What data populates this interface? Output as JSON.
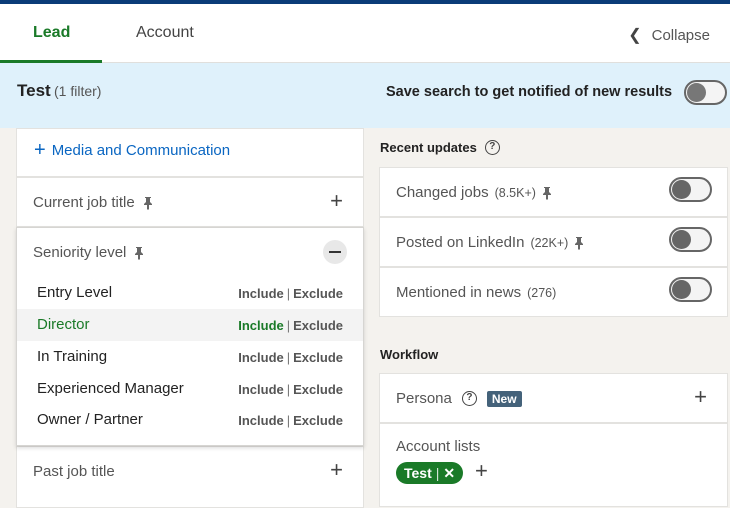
{
  "tabs": {
    "lead": "Lead",
    "account": "Account",
    "collapse": "Collapse"
  },
  "banner": {
    "title": "Test",
    "filter_count": "(1 filter)",
    "save_text": "Save search to get notified of new results"
  },
  "left": {
    "media_label": "Media and Communication",
    "job_title": "Current job title",
    "seniority_title": "Seniority level",
    "seniority_items": [
      {
        "name": "Entry Level",
        "include": "Include",
        "exclude": "Exclude"
      },
      {
        "name": "Director",
        "include": "Include",
        "exclude": "Exclude"
      },
      {
        "name": "In Training",
        "include": "Include",
        "exclude": "Exclude"
      },
      {
        "name": "Experienced Manager",
        "include": "Include",
        "exclude": "Exclude"
      },
      {
        "name": "Owner / Partner",
        "include": "Include",
        "exclude": "Exclude"
      }
    ],
    "separator": "|",
    "past_job_title": "Past job title"
  },
  "right": {
    "recent_updates_title": "Recent updates",
    "updates": [
      {
        "label": "Changed jobs",
        "count": "(8.5K+)"
      },
      {
        "label": "Posted on LinkedIn",
        "count": "(22K+)"
      },
      {
        "label": "Mentioned in news",
        "count": "(276)"
      }
    ],
    "workflow_title": "Workflow",
    "persona_label": "Persona",
    "persona_badge": "New",
    "account_lists_title": "Account lists",
    "account_list_tag": "Test",
    "account_list_tag_remove": "✕"
  },
  "colors": {
    "accent_green": "#1a7a28",
    "link_blue": "#0a66c2",
    "banner_bg": "#dff1fb"
  }
}
